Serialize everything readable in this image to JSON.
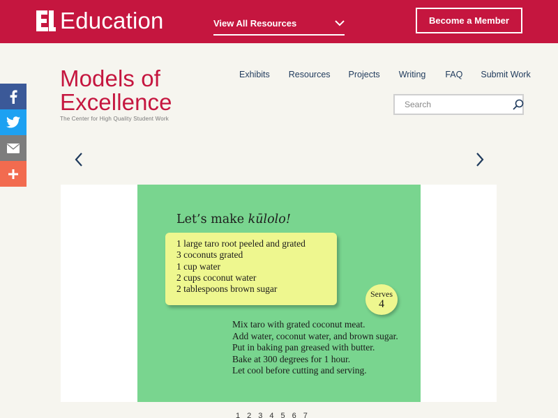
{
  "topbar": {
    "brand": "Education",
    "resources_dropdown": "View All Resources",
    "member_button": "Become a Member"
  },
  "site": {
    "logo_line1": "Models of",
    "logo_line2": "Excellence",
    "tagline": "The Center for High Quality Student Work"
  },
  "nav": [
    "Exhibits",
    "Resources",
    "Projects",
    "Writing",
    "FAQ",
    "Submit Work"
  ],
  "search": {
    "placeholder": "Search"
  },
  "social": [
    "facebook-icon",
    "twitter-icon",
    "email-icon",
    "plus-icon"
  ],
  "slide": {
    "title_prefix": "Let’s make ",
    "title_word": "kūlolo!",
    "ingredients": [
      "1 large taro root peeled and grated",
      "3 coconuts grated",
      "1 cup water",
      "2 cups coconut water",
      "2 tablespoons brown sugar"
    ],
    "serves_label": "Serves",
    "serves_count": "4",
    "steps": [
      "Mix taro with grated coconut meat.",
      "Add water, coconut water, and brown sugar.",
      "Put in baking pan greased with butter.",
      "Bake at 300 degrees for 1 hour.",
      "Let cool before cutting and serving."
    ]
  },
  "pager": [
    "1",
    "2",
    "3",
    "4",
    "5",
    "6",
    "7"
  ],
  "colors": {
    "brand": "#c5163f",
    "nav_text": "#1f3a5c",
    "slide_bg": "#79d58f",
    "card_bg": "#eef78f"
  }
}
